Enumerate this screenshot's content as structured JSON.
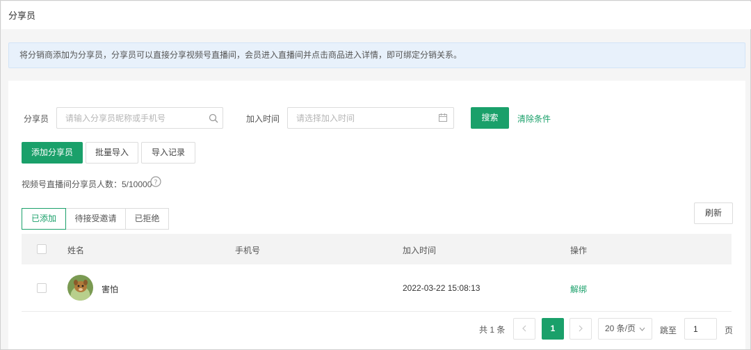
{
  "page": {
    "title": "分享员"
  },
  "notice": {
    "text": "将分销商添加为分享员，分享员可以直接分享视频号直播间，会员进入直播间并点击商品进入详情，即可绑定分销关系。"
  },
  "filters": {
    "sharer_label": "分享员",
    "sharer_placeholder": "请输入分享员昵称或手机号",
    "time_label": "加入时间",
    "time_placeholder": "请选择加入时间",
    "search_button": "搜索",
    "clear_link": "清除条件"
  },
  "actions": {
    "add_button": "添加分享员",
    "batch_import_button": "批量导入",
    "import_log_button": "导入记录"
  },
  "summary": {
    "text": "视频号直播间分享员人数：5/10000"
  },
  "tabs": [
    {
      "label": "已添加"
    },
    {
      "label": "待接受邀请"
    },
    {
      "label": "已拒绝"
    }
  ],
  "refresh_button": "刷新",
  "table": {
    "headers": {
      "name": "姓名",
      "phone": "手机号",
      "joined": "加入时间",
      "actions": "操作"
    },
    "rows": [
      {
        "name": "害怕",
        "phone": "",
        "joined": "2022-03-22 15:08:13",
        "action": "解绑"
      }
    ]
  },
  "pagination": {
    "total": "共 1 条",
    "current": "1",
    "page_size": "20 条/页",
    "jump_label": "跳至",
    "jump_value": "1",
    "page_suffix": "页"
  },
  "colors": {
    "accent": "#1aa06a",
    "notice_bg": "#e8f1fb"
  }
}
